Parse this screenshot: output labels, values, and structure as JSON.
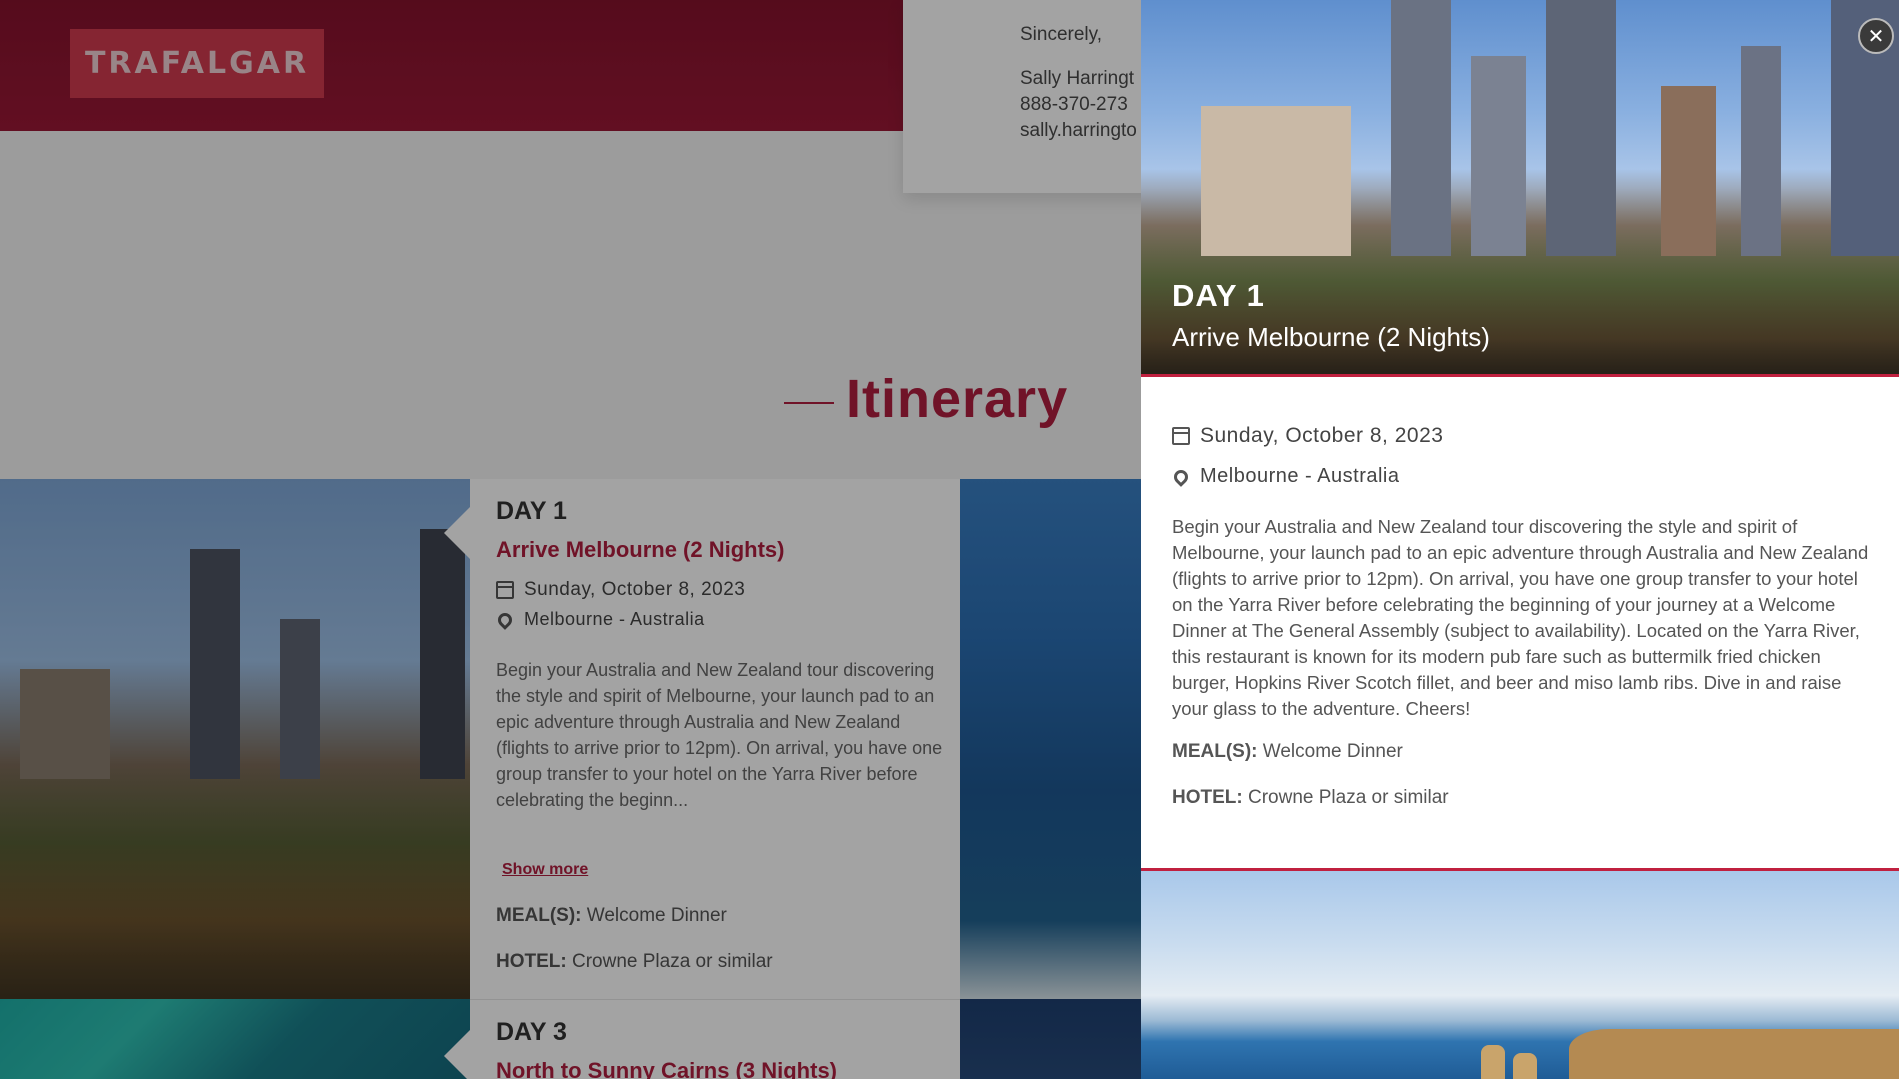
{
  "brand": {
    "logo_text": "TRAFALGAR"
  },
  "letter": {
    "closing": "Sincerely,",
    "name": "Sally Harringt",
    "phone": "888-370-273",
    "email": "sally.harringto"
  },
  "itinerary": {
    "heading": "Itinerary"
  },
  "days": [
    {
      "day_label": "DAY 1",
      "title": "Arrive Melbourne (2 Nights)",
      "date": "Sunday, October 8, 2023",
      "location": "Melbourne - Australia",
      "excerpt": "Begin your Australia and New Zealand tour discovering the style and spirit of Melbourne, your launch pad to an epic adventure through Australia and New Zealand (flights to arrive prior to 12pm). On arrival, you have one group transfer to your hotel on the Yarra River before celebrating the beginn...",
      "show_more": "Show more",
      "meals_label": "MEAL(S):",
      "meals_value": "Welcome Dinner",
      "hotel_label": "HOTEL:",
      "hotel_value": "Crowne Plaza or similar"
    },
    {
      "day_label": "DAY 3",
      "title": "North to Sunny Cairns (3 Nights)"
    }
  ],
  "panel": {
    "day_label": "DAY 1",
    "title": "Arrive Melbourne (2 Nights)",
    "date": "Sunday, October 8, 2023",
    "location": "Melbourne - Australia",
    "description": "Begin your Australia and New Zealand tour discovering the style and spirit of Melbourne, your launch pad to an epic adventure through Australia and New Zealand (flights to arrive prior to 12pm). On arrival, you have one group transfer to your hotel on the Yarra River before celebrating the beginning of your journey at a Welcome Dinner at The General Assembly (subject to availability). Located on the Yarra River, this restaurant is known for its modern pub fare such as buttermilk fried chicken burger, Hopkins River Scotch fillet, and beer and miso lamb ribs. Dive in and raise your glass to the adventure. Cheers!",
    "meals_label": "MEAL(S):",
    "meals_value": "Welcome Dinner",
    "hotel_label": "HOTEL:",
    "hotel_value": "Crowne Plaza or similar",
    "close_icon": "close-icon",
    "accent_color": "#c0203f"
  },
  "icons": {
    "date": "calendar-icon",
    "location": "map-pin-icon"
  }
}
